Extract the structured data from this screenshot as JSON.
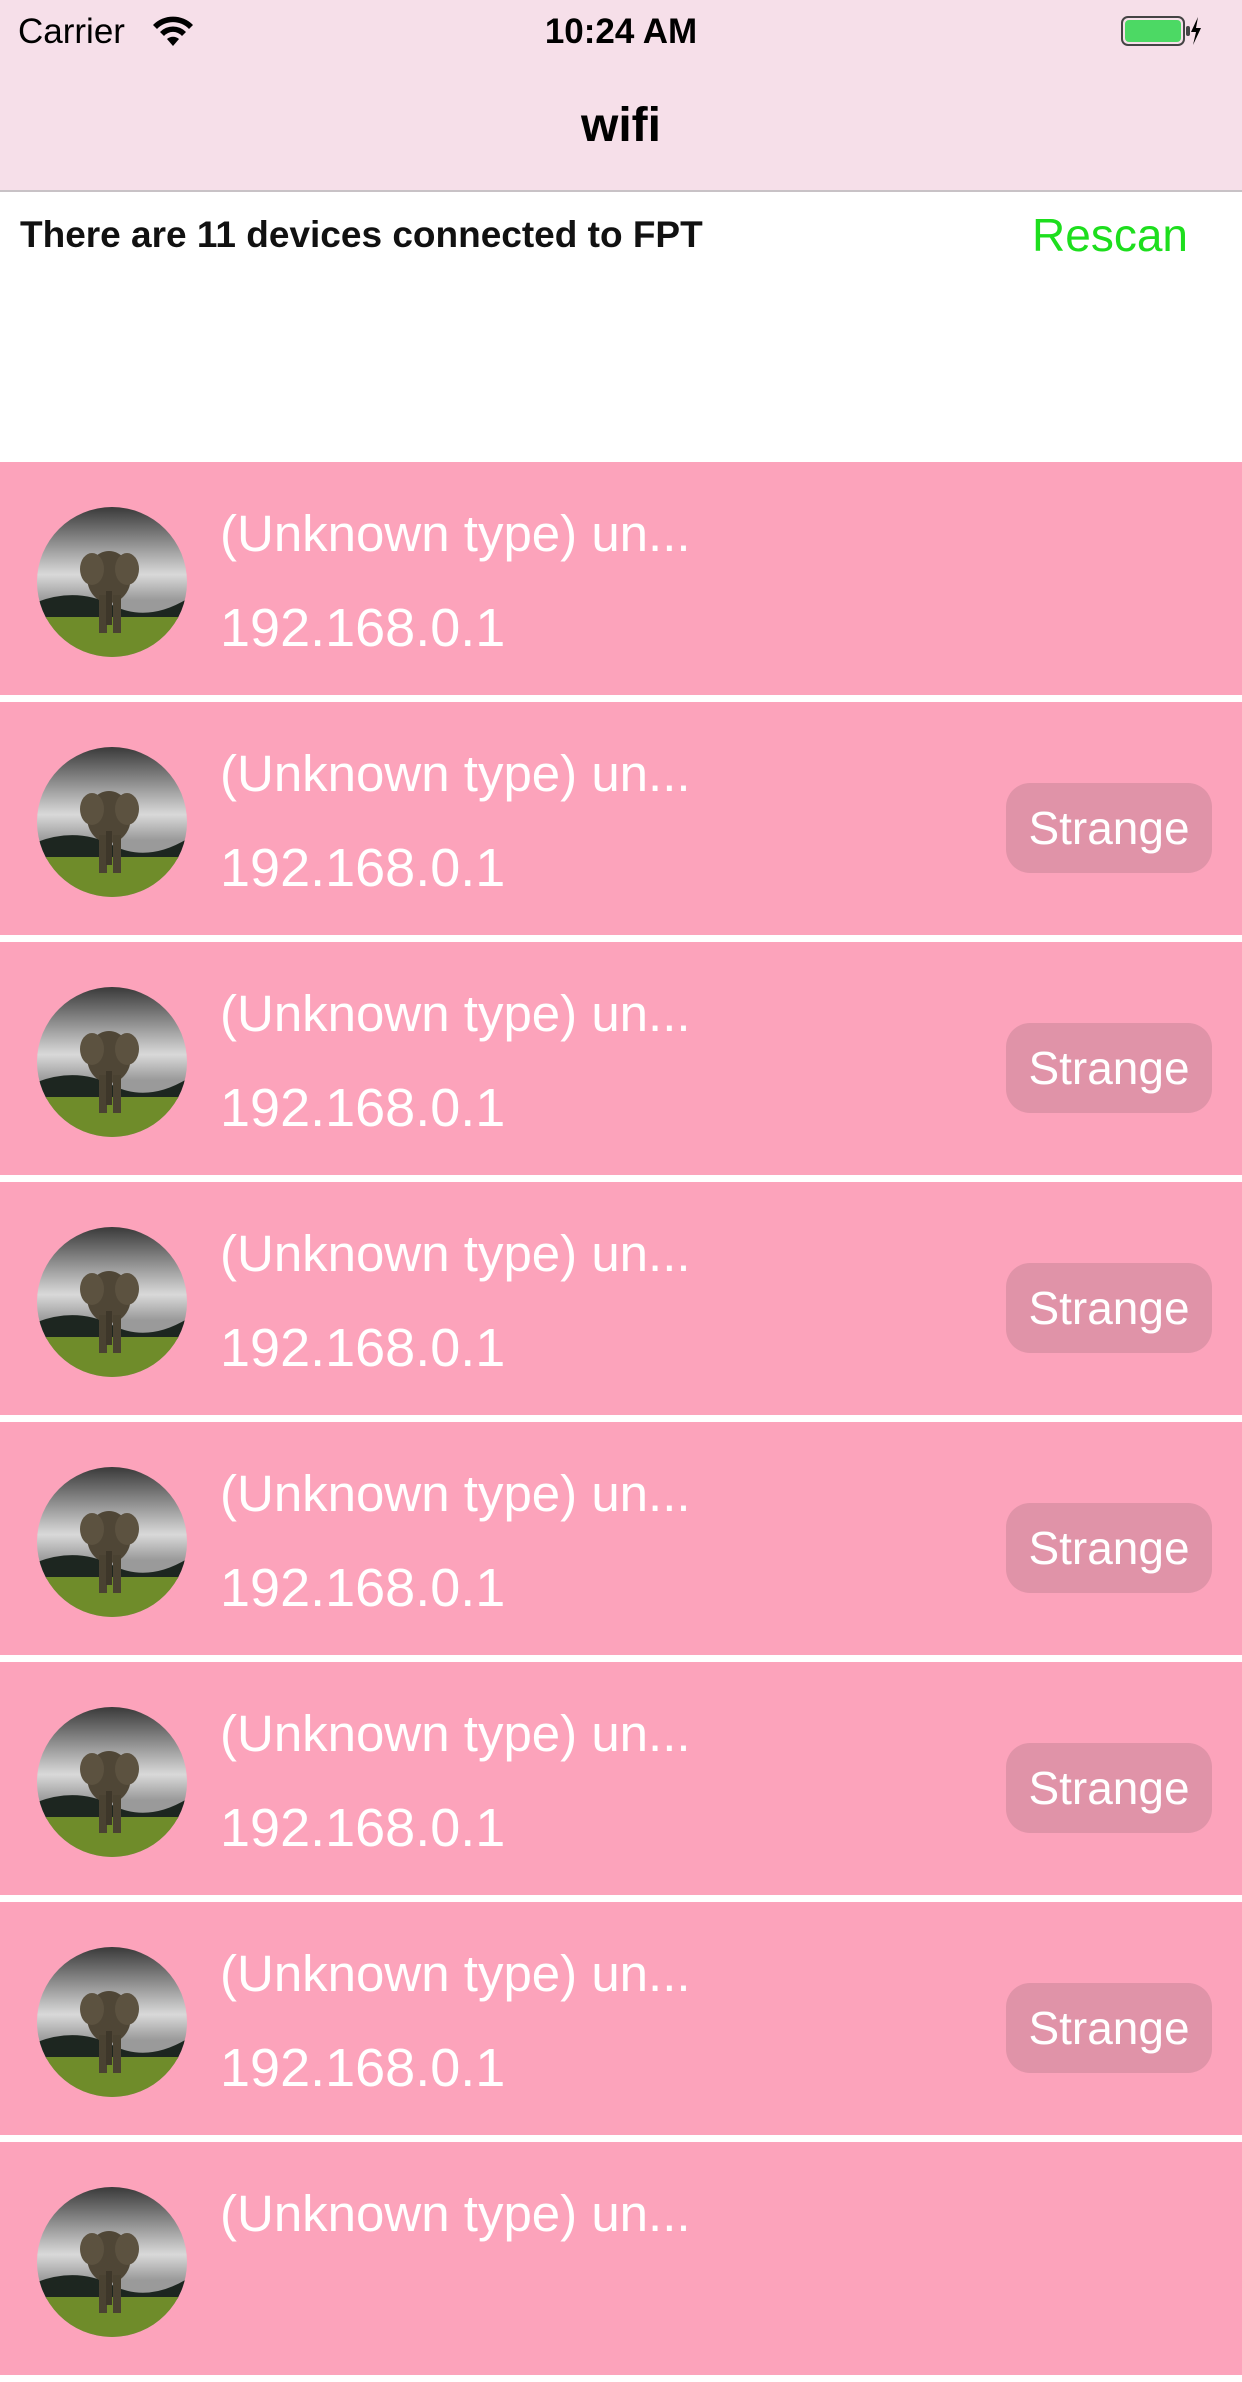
{
  "status_bar": {
    "carrier": "Carrier",
    "time": "10:24 AM",
    "icons": [
      "wifi-icon",
      "battery-icon",
      "charging-bolt-icon"
    ]
  },
  "nav": {
    "title": "wifi"
  },
  "header": {
    "summary": "There are 11 devices connected to FPT",
    "rescan_label": "Rescan"
  },
  "colors": {
    "bars_bg": "#f6dfe9",
    "row_bg": "#fca3bb",
    "button_bg": "#e093a8",
    "rescan": "#1dde1d"
  },
  "devices": [
    {
      "name": "(Unknown type) un...",
      "ip": "192.168.0.1",
      "tag": ""
    },
    {
      "name": "(Unknown type) un...",
      "ip": "192.168.0.1",
      "tag": "Strange"
    },
    {
      "name": "(Unknown type) un...",
      "ip": "192.168.0.1",
      "tag": "Strange"
    },
    {
      "name": "(Unknown type) un...",
      "ip": "192.168.0.1",
      "tag": "Strange"
    },
    {
      "name": "(Unknown type) un...",
      "ip": "192.168.0.1",
      "tag": "Strange"
    },
    {
      "name": "(Unknown type) un...",
      "ip": "192.168.0.1",
      "tag": "Strange"
    },
    {
      "name": "(Unknown type) un...",
      "ip": "192.168.0.1",
      "tag": "Strange"
    },
    {
      "name": "(Unknown type) un...",
      "ip": "",
      "tag": ""
    }
  ]
}
